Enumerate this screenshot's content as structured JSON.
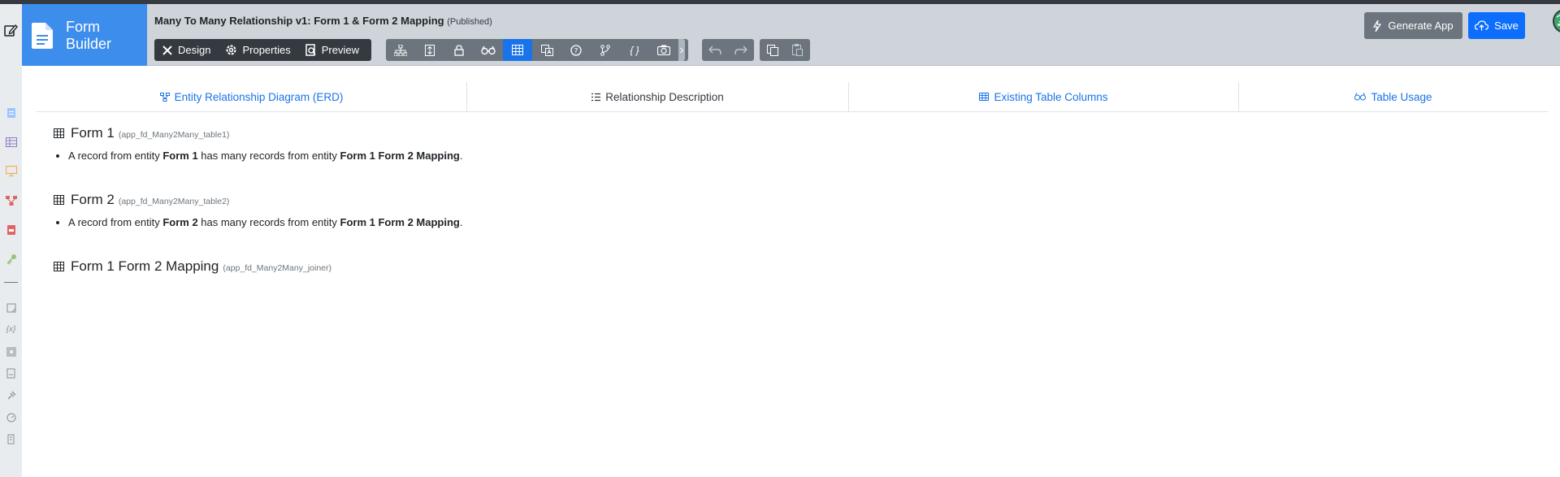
{
  "sidebar": {
    "icons": [
      "file-icon",
      "table-icon",
      "monitor-icon",
      "flow-icon",
      "pdf-icon",
      "key-icon",
      "note-icon",
      "variable-icon",
      "dataset-icon",
      "document-icon",
      "plugin-icon",
      "dashboard-icon",
      "script-icon"
    ]
  },
  "brand": {
    "line1": "Form",
    "line2": "Builder"
  },
  "header": {
    "title": "Many To Many Relationship v1: Form 1 & Form 2 Mapping",
    "status": "(Published)"
  },
  "toolbar": {
    "design_label": "Design",
    "properties_label": "Properties",
    "preview_label": "Preview",
    "generate_app_label": "Generate App",
    "save_label": "Save"
  },
  "tabs": [
    {
      "label": "Entity Relationship Diagram (ERD)",
      "icon": "erd-icon"
    },
    {
      "label": "Relationship Description",
      "icon": "list-icon"
    },
    {
      "label": "Existing Table Columns",
      "icon": "table-icon"
    },
    {
      "label": "Table Usage",
      "icon": "binoculars-icon"
    }
  ],
  "entities": [
    {
      "name": "Form 1",
      "table": "(app_fd_Many2Many_table1)",
      "desc_prefix": "A record from entity ",
      "desc_entity": "Form 1",
      "desc_mid": " has many records from entity ",
      "desc_target": "Form 1 Form 2 Mapping",
      "desc_end": "."
    },
    {
      "name": "Form 2",
      "table": "(app_fd_Many2Many_table2)",
      "desc_prefix": "A record from entity ",
      "desc_entity": "Form 2",
      "desc_mid": " has many records from entity ",
      "desc_target": "Form 1 Form 2 Mapping",
      "desc_end": "."
    },
    {
      "name": "Form 1 Form 2 Mapping",
      "table": "(app_fd_Many2Many_joiner)"
    }
  ],
  "colors": {
    "brand": "#3c8dec",
    "header": "#ced4da",
    "accent": "#1a73e8",
    "save": "#0d6efd"
  }
}
